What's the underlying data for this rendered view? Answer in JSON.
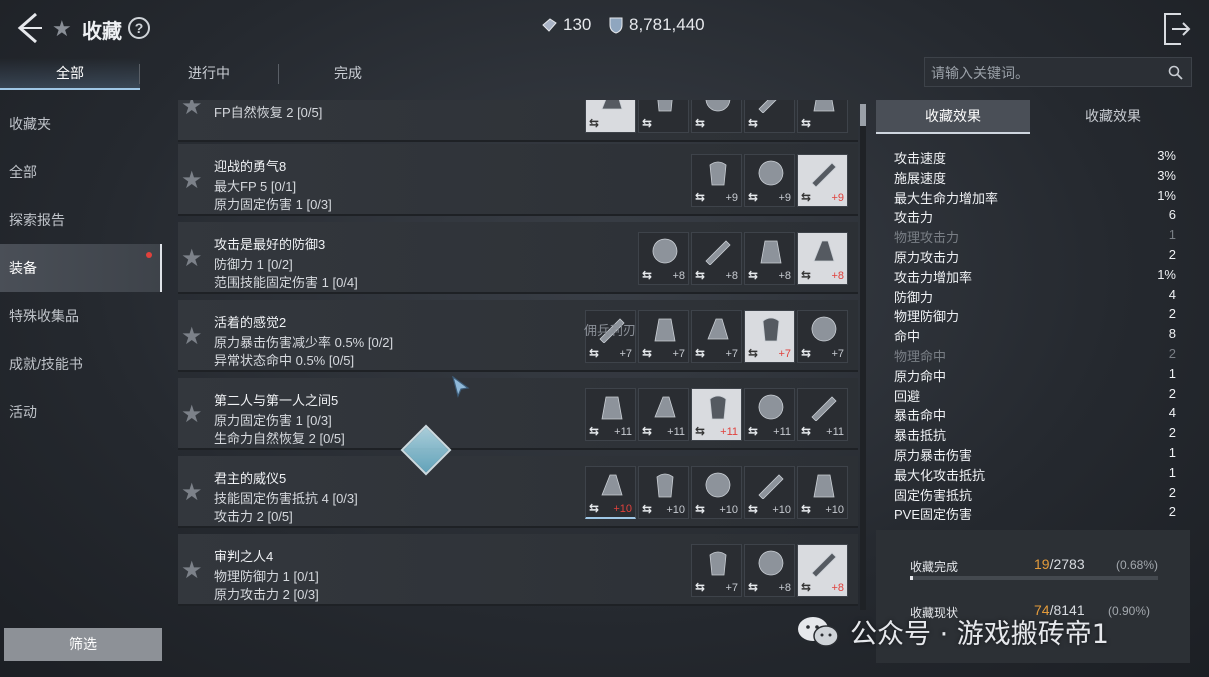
{
  "header": {
    "title": "收藏",
    "help": "?",
    "currency1": "130",
    "currency2": "8,781,440"
  },
  "tabs": [
    "全部",
    "进行中",
    "完成"
  ],
  "search": {
    "placeholder": "请输入关键词。"
  },
  "sidebar": {
    "items": [
      {
        "label": "收藏夹"
      },
      {
        "label": "全部"
      },
      {
        "label": "探索报告"
      },
      {
        "label": "装备"
      },
      {
        "label": "特殊收集品"
      },
      {
        "label": "成就/技能书"
      },
      {
        "label": "活动"
      }
    ],
    "filter": "筛选"
  },
  "list": {
    "overlay_text": "佣兵利刃",
    "rows": [
      {
        "name": "",
        "stat1": "FP自然恢复 2 [0/5]",
        "stat2": "",
        "items": [
          {
            "lvl": "",
            "red": false,
            "hl": true
          },
          {
            "lvl": "",
            "red": false
          },
          {
            "lvl": "",
            "red": false
          },
          {
            "lvl": "",
            "red": false
          },
          {
            "lvl": "",
            "red": false
          }
        ]
      },
      {
        "name": "迎战的勇气8",
        "stat1": "最大FP 5 [0/1]",
        "stat2": "原力固定伤害 1 [0/3]",
        "items": [
          {
            "lvl": "+9",
            "red": false
          },
          {
            "lvl": "+9",
            "red": false
          },
          {
            "lvl": "+9",
            "red": true,
            "hl": true
          }
        ]
      },
      {
        "name": "攻击是最好的防御3",
        "stat1": "防御力 1 [0/2]",
        "stat2": "范围技能固定伤害 1 [0/4]",
        "items": [
          {
            "lvl": "+8",
            "red": false
          },
          {
            "lvl": "+8",
            "red": false
          },
          {
            "lvl": "+8",
            "red": false
          },
          {
            "lvl": "+8",
            "red": true,
            "hl": true
          }
        ]
      },
      {
        "name": "活着的感觉2",
        "stat1": "原力暴击伤害减少率 0.5% [0/2]",
        "stat2": "异常状态命中 0.5% [0/5]",
        "items": [
          {
            "lvl": "+7",
            "red": false
          },
          {
            "lvl": "+7",
            "red": false
          },
          {
            "lvl": "+7",
            "red": false
          },
          {
            "lvl": "+7",
            "red": true,
            "hl": true
          },
          {
            "lvl": "+7",
            "red": false
          }
        ]
      },
      {
        "name": "第二人与第一人之间5",
        "stat1": "原力固定伤害 1 [0/3]",
        "stat2": "生命力自然恢复 2 [0/5]",
        "items": [
          {
            "lvl": "+11",
            "red": false
          },
          {
            "lvl": "+11",
            "red": false
          },
          {
            "lvl": "+11",
            "red": true,
            "hl": true
          },
          {
            "lvl": "+11",
            "red": false
          },
          {
            "lvl": "+11",
            "red": false
          }
        ]
      },
      {
        "name": "君主的威仪5",
        "stat1": "技能固定伤害抵抗 4 [0/3]",
        "stat2": "攻击力 2 [0/5]",
        "items": [
          {
            "lvl": "+10",
            "red": true,
            "sel": true
          },
          {
            "lvl": "+10",
            "red": false
          },
          {
            "lvl": "+10",
            "red": false
          },
          {
            "lvl": "+10",
            "red": false
          },
          {
            "lvl": "+10",
            "red": false
          }
        ]
      },
      {
        "name": "审判之人4",
        "stat1": "物理防御力 1 [0/1]",
        "stat2": "原力攻击力 2 [0/3]",
        "items": [
          {
            "lvl": "+7",
            "red": false
          },
          {
            "lvl": "+8",
            "red": false
          },
          {
            "lvl": "+8",
            "red": true,
            "hl": true
          }
        ]
      }
    ]
  },
  "right_panel": {
    "tabs": [
      "收藏效果",
      "收藏效果"
    ],
    "effects": [
      {
        "name": "攻击速度",
        "value": "3%",
        "dim": false
      },
      {
        "name": "施展速度",
        "value": "3%",
        "dim": false
      },
      {
        "name": "最大生命力增加率",
        "value": "1%",
        "dim": false
      },
      {
        "name": "攻击力",
        "value": "6",
        "dim": false
      },
      {
        "name": "物理攻击力",
        "value": "1",
        "dim": true
      },
      {
        "name": "原力攻击力",
        "value": "2",
        "dim": false
      },
      {
        "name": "攻击力增加率",
        "value": "1%",
        "dim": false
      },
      {
        "name": "防御力",
        "value": "4",
        "dim": false
      },
      {
        "name": "物理防御力",
        "value": "2",
        "dim": false
      },
      {
        "name": "命中",
        "value": "8",
        "dim": false
      },
      {
        "name": "物理命中",
        "value": "2",
        "dim": true
      },
      {
        "name": "原力命中",
        "value": "1",
        "dim": false
      },
      {
        "name": "回避",
        "value": "2",
        "dim": false
      },
      {
        "name": "暴击命中",
        "value": "4",
        "dim": false
      },
      {
        "name": "暴击抵抗",
        "value": "2",
        "dim": false
      },
      {
        "name": "原力暴击伤害",
        "value": "1",
        "dim": false
      },
      {
        "name": "最大化攻击抵抗",
        "value": "1",
        "dim": false
      },
      {
        "name": "固定伤害抵抗",
        "value": "2",
        "dim": false
      },
      {
        "name": "PVE固定伤害",
        "value": "2",
        "dim": false
      }
    ],
    "progress": [
      {
        "label": "收藏完成",
        "num": "19",
        "total": "/2783",
        "pct": "(0.68%)",
        "fill": 0.0068
      },
      {
        "label": "收藏现状",
        "num": "74",
        "total": "/8141",
        "pct": "(0.90%)",
        "fill": 0.009
      }
    ]
  },
  "watermark": "公众号 · 游戏搬砖帝1",
  "colors": {
    "accent": "#9fc7e6",
    "red": "#e0413c",
    "orange": "#e39b3b"
  }
}
